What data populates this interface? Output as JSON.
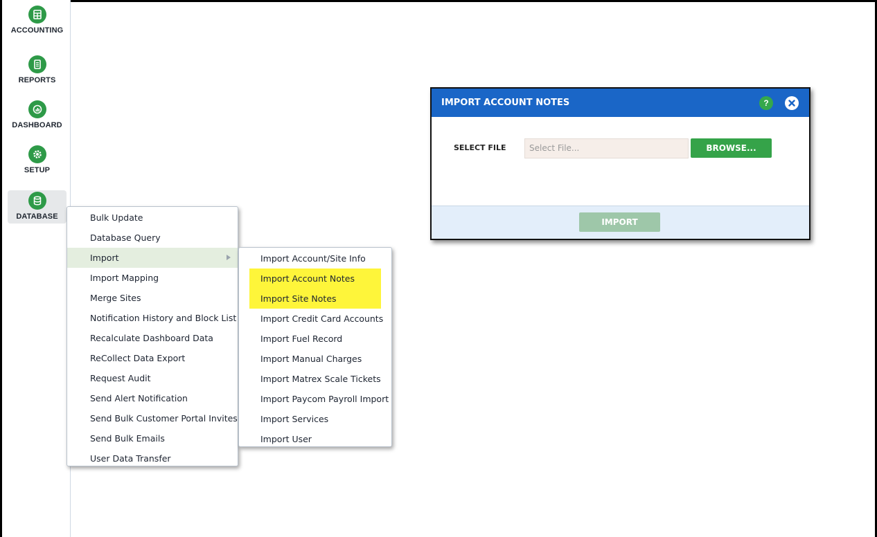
{
  "sidebar": {
    "items": [
      {
        "label": "ACCOUNTING",
        "icon": "accounting-icon"
      },
      {
        "label": "REPORTS",
        "icon": "reports-icon"
      },
      {
        "label": "DASHBOARD",
        "icon": "dashboard-icon"
      },
      {
        "label": "SETUP",
        "icon": "gear-icon"
      },
      {
        "label": "DATABASE",
        "icon": "database-icon",
        "active": true
      }
    ]
  },
  "database_menu": {
    "items": [
      "Bulk Update",
      "Database Query",
      "Import",
      "Import Mapping",
      "Merge Sites",
      "Notification History and Block List",
      "Recalculate Dashboard Data",
      "ReCollect Data Export",
      "Request Audit",
      "Send Alert Notification",
      "Send Bulk Customer Portal Invites",
      "Send Bulk Emails",
      "User Data Transfer"
    ],
    "hovered": "Import"
  },
  "import_submenu": {
    "items": [
      "Import Account/Site Info",
      "Import Account Notes",
      "Import Site Notes",
      "Import Credit Card Accounts",
      "Import Fuel Record",
      "Import Manual Charges",
      "Import Matrex Scale Tickets",
      "Import Paycom Payroll Import",
      "Import Services",
      "Import User"
    ],
    "highlighted": [
      "Import Account Notes",
      "Import Site Notes"
    ],
    "highlight_color": "#fef53a"
  },
  "dialog": {
    "title": "IMPORT ACCOUNT NOTES",
    "help_label": "?",
    "select_file_label": "SELECT FILE",
    "file_placeholder": "Select File...",
    "browse_label": "BROWSE...",
    "import_label": "IMPORT"
  },
  "colors": {
    "brand_green": "#2e9a48",
    "header_blue": "#1a66c7",
    "highlight_yellow": "#fef53a",
    "import_disabled": "#9ec7a9"
  }
}
